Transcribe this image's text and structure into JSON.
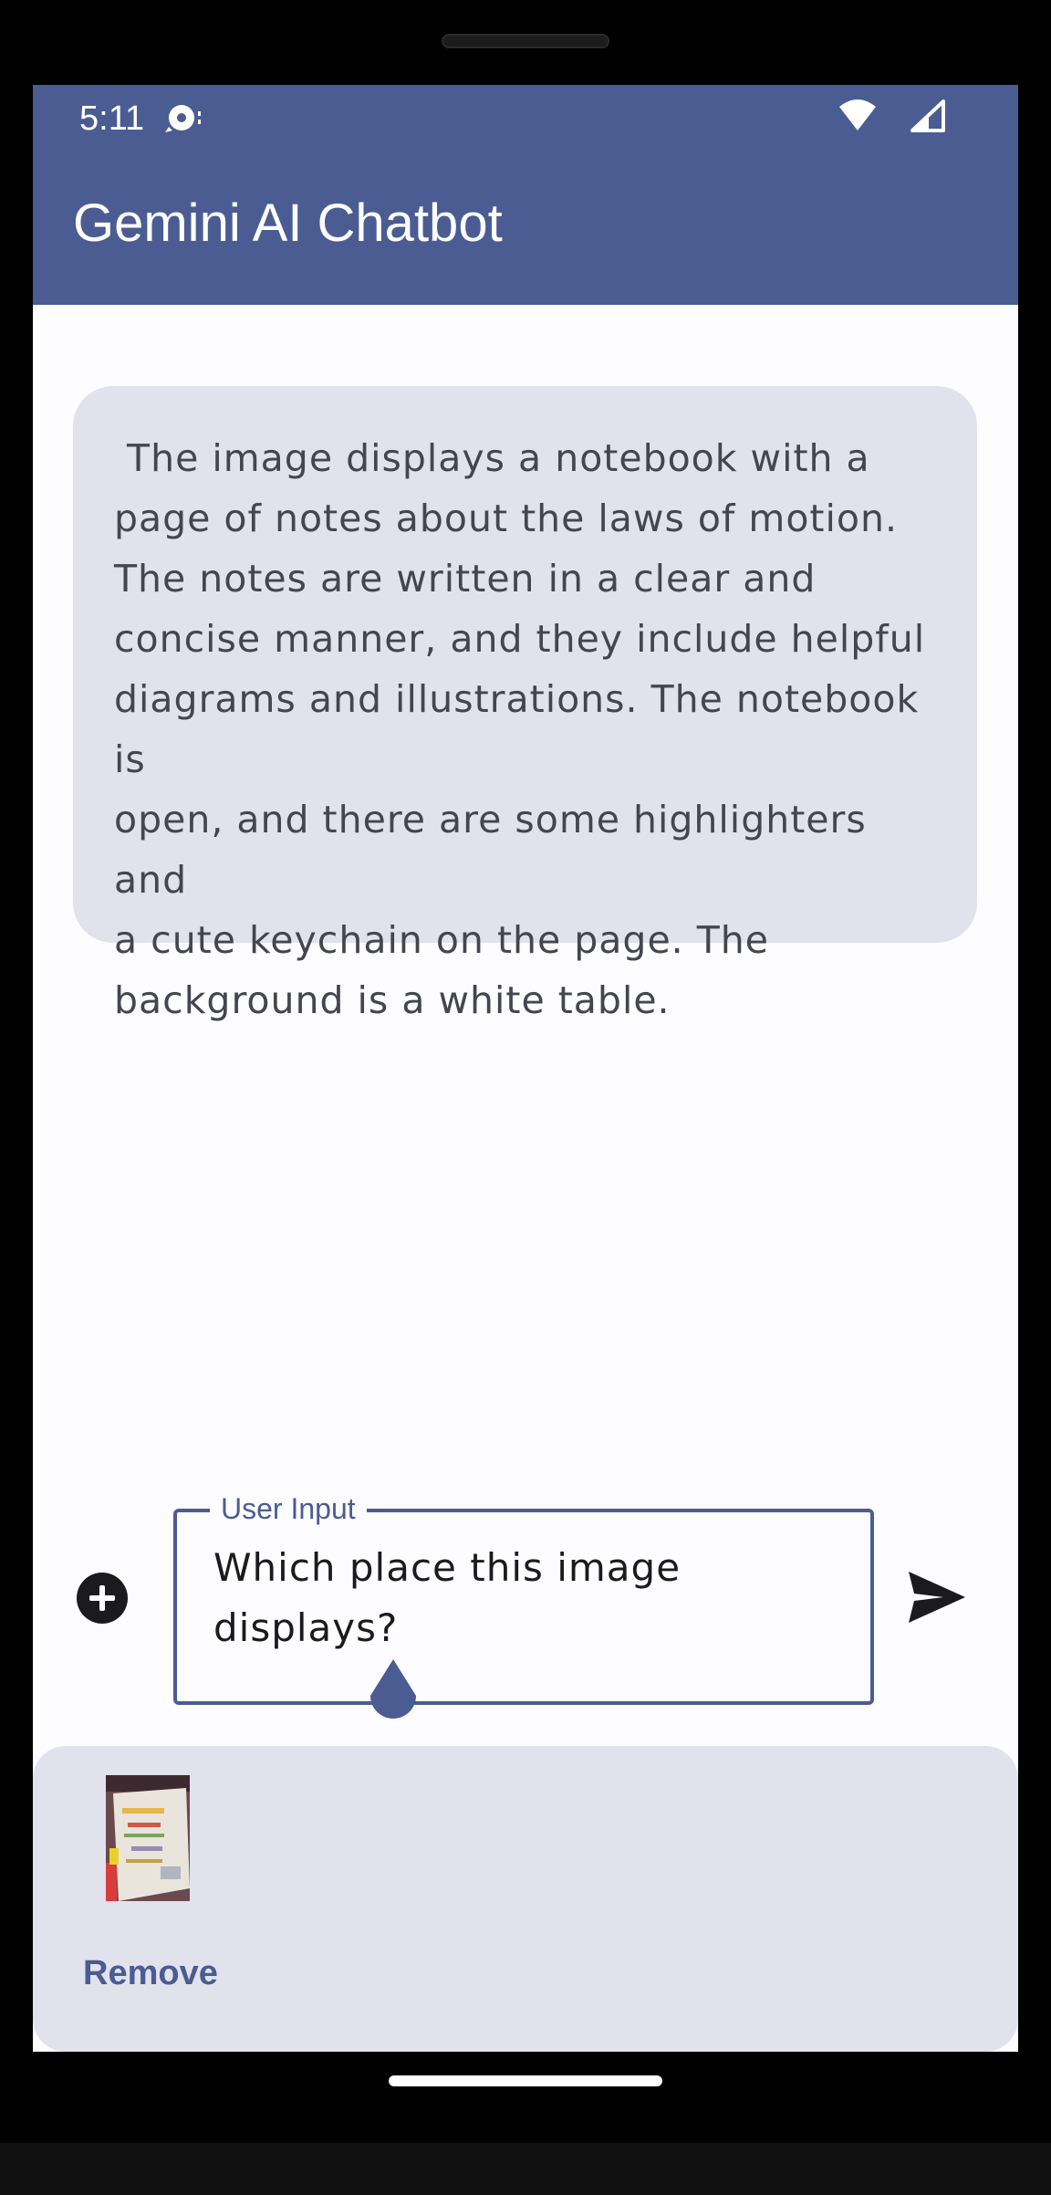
{
  "status_bar": {
    "time": "5:11",
    "left_icon": "media-sync-icon",
    "right_icons": [
      "wifi-icon",
      "signal-icon"
    ]
  },
  "app_bar": {
    "title": "Gemini AI Chatbot",
    "color": "#4a5c92"
  },
  "messages": [
    {
      "role": "model",
      "text": " The image displays a notebook with a\npage of notes about the laws of motion.\nThe notes are written in a clear and\nconcise manner, and they include helpful\ndiagrams and illustrations. The notebook is\nopen, and there are some highlighters and\na cute keychain on the page. The\nbackground is a white table."
    }
  ],
  "composer": {
    "add_icon": "add-circle-icon",
    "label": "User Input",
    "value": "Which place this image\ndisplays?",
    "send_icon": "send-icon"
  },
  "attachment": {
    "thumbnail": "notebook-image-thumbnail",
    "remove_label": "Remove"
  },
  "colors": {
    "primary": "#4a5c92",
    "bubble": "#e1e2ec",
    "surface": "#fdfcff"
  }
}
